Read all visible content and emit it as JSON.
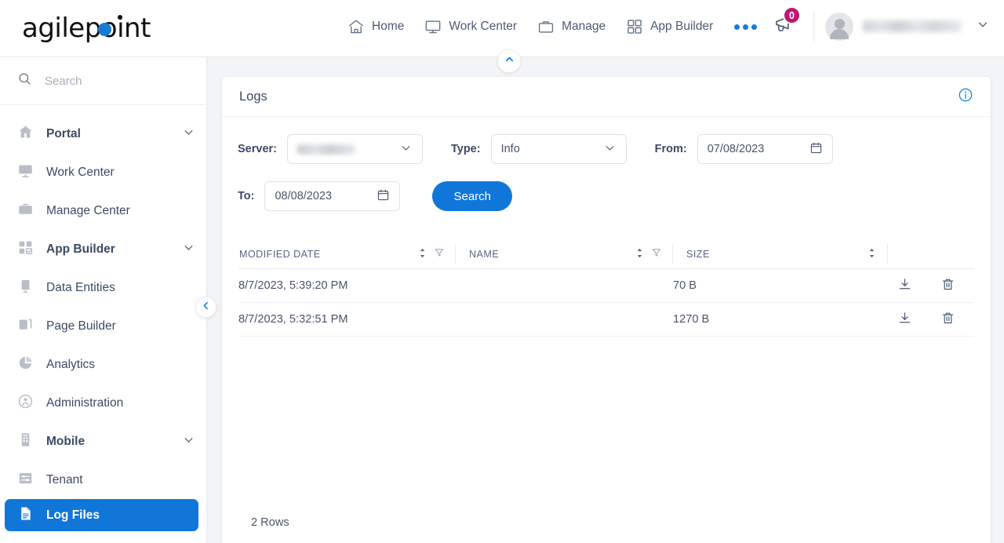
{
  "header": {
    "logo_text": "agilepoint",
    "logo_accent_color": "#1a7bd4",
    "nav": [
      {
        "label": "Home",
        "icon": "home-icon"
      },
      {
        "label": "Work Center",
        "icon": "monitor-icon"
      },
      {
        "label": "Manage",
        "icon": "briefcase-icon"
      },
      {
        "label": "App Builder",
        "icon": "grid-icon"
      }
    ],
    "more_icon": "ellipsis-icon",
    "notification_icon": "megaphone-icon",
    "notification_count": "0",
    "notification_badge_color": "#bf1774",
    "user_name": "",
    "user_chevron": "chevron-down-icon",
    "collapse_header_icon": "chevron-up-icon"
  },
  "sidebar": {
    "search_placeholder": "Search",
    "search_value": "",
    "collapse_icon": "chevron-left-icon",
    "items": [
      {
        "label": "Portal",
        "icon": "home-icon",
        "bold": true,
        "chevron": true,
        "active": false
      },
      {
        "label": "Work Center",
        "icon": "monitor-list-icon",
        "bold": false,
        "chevron": false,
        "active": false
      },
      {
        "label": "Manage Center",
        "icon": "briefcase-icon",
        "bold": false,
        "chevron": false,
        "active": false
      },
      {
        "label": "App Builder",
        "icon": "grid-check-icon",
        "bold": true,
        "chevron": true,
        "active": false
      },
      {
        "label": "Data Entities",
        "icon": "database-icon",
        "bold": false,
        "chevron": false,
        "active": false
      },
      {
        "label": "Page Builder",
        "icon": "pages-icon",
        "bold": false,
        "chevron": false,
        "active": false
      },
      {
        "label": "Analytics",
        "icon": "pie-chart-icon",
        "bold": false,
        "chevron": false,
        "active": false
      },
      {
        "label": "Administration",
        "icon": "user-admin-icon",
        "bold": false,
        "chevron": false,
        "active": false
      },
      {
        "label": "Mobile",
        "icon": "mobile-icon",
        "bold": true,
        "chevron": true,
        "active": false
      },
      {
        "label": "Tenant",
        "icon": "sliders-icon",
        "bold": false,
        "chevron": false,
        "active": false
      },
      {
        "label": "Log Files",
        "icon": "document-icon",
        "bold": false,
        "chevron": false,
        "active": true
      }
    ],
    "active_color": "#1077d9"
  },
  "main": {
    "card_title": "Logs",
    "info_icon": "info-circle-icon",
    "filters": {
      "server_label": "Server:",
      "server_value": "",
      "type_label": "Type:",
      "type_value": "Info",
      "from_label": "From:",
      "from_value": "07/08/2023",
      "to_label": "To:",
      "to_value": "08/08/2023",
      "calendar_icon": "calendar-icon",
      "dropdown_icon": "chevron-down-icon",
      "search_button": "Search",
      "search_button_color": "#1077d9"
    },
    "table": {
      "columns": [
        {
          "label": "MODIFIED DATE",
          "sort": true,
          "filter": true
        },
        {
          "label": "NAME",
          "sort": true,
          "filter": true
        },
        {
          "label": "SIZE",
          "sort": true,
          "filter": false
        }
      ],
      "rows": [
        {
          "modified_date": "8/7/2023, 5:39:20 PM",
          "name": "",
          "size": "70 B",
          "download_icon": "download-icon",
          "delete_icon": "trash-icon"
        },
        {
          "modified_date": "8/7/2023, 5:32:51 PM",
          "name": "",
          "size": "1270 B",
          "download_icon": "download-icon",
          "delete_icon": "trash-icon"
        }
      ],
      "row_count_label": "2 Rows"
    }
  }
}
